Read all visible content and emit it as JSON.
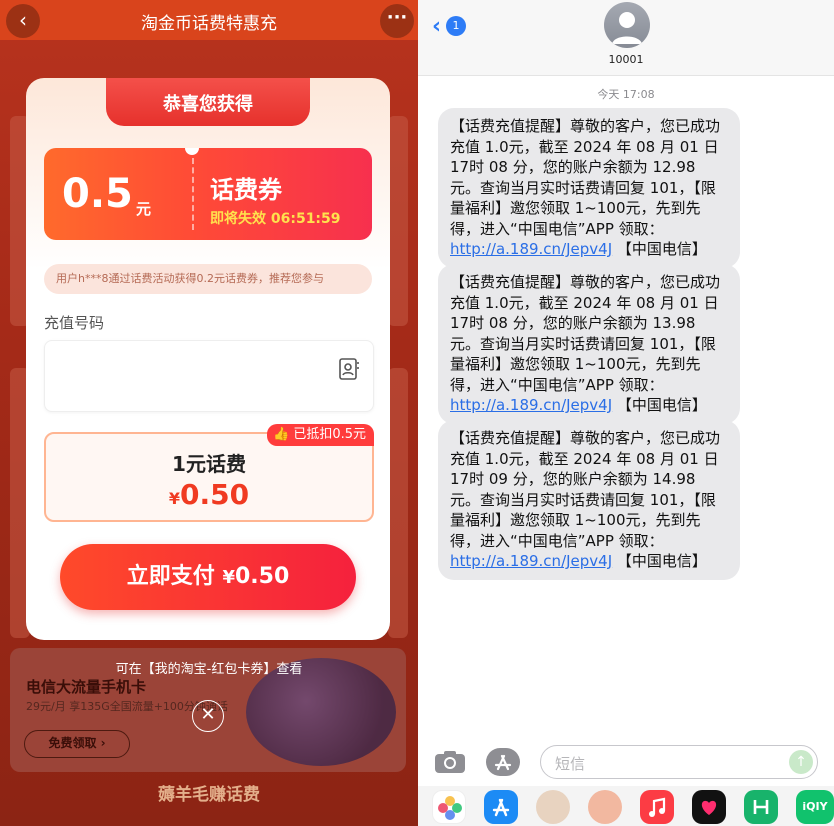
{
  "left": {
    "header": {
      "title": "淘金币话费特惠充",
      "back_icon": "chevron-left-icon",
      "more_icon": "more-dots-icon"
    },
    "modal": {
      "heading": "恭喜您获得",
      "coupon": {
        "amount": "0.5",
        "unit": "元",
        "name": "话费券",
        "expire_text": "即将失效 06:51:59"
      },
      "notice": "用户h***8通过话费活动获得0.2元话费券，推荐您参与",
      "phone_label": "充值号码",
      "phone_value": "",
      "product": {
        "badge": "已抵扣0.5元",
        "name": "1元话费",
        "currency": "¥",
        "price": "0.50"
      },
      "pay_button": {
        "label": "立即支付",
        "currency": "¥",
        "amount": "0.50"
      }
    },
    "below_tip": "可在【我的淘宝-红包卡券】查看",
    "promo": {
      "title": "电信大流量手机卡",
      "subtitle": "29元/月 享135G全国流量+100分钟通话",
      "button": "免费领取 ›"
    },
    "section_title": "薅羊毛赚话费"
  },
  "right": {
    "header": {
      "back_badge": "1",
      "contact_name": "10001"
    },
    "timestamp": "今天 17:08",
    "messages": [
      {
        "line1": "【话费充值提醒】尊敬的客户，您已成功充值 1.0元，截至 2024 年 08 月 01 日 17时 08 分，您的账户余额为 12.98 元。查询当月实时话费请回复 101，【限量福利】邀您领取 1~100元，先到先得，进入“中国电信”APP 领取：",
        "link": "http://a.189.cn/Jepv4J",
        "tail": " 【中国电信】"
      },
      {
        "line1": "【话费充值提醒】尊敬的客户，您已成功充值 1.0元，截至 2024 年 08 月 01 日 17时 08 分，您的账户余额为 13.98 元。查询当月实时话费请回复 101，【限量福利】邀您领取 1~100元，先到先得，进入“中国电信”APP 领取：",
        "link": "http://a.189.cn/Jepv4J",
        "tail": " 【中国电信】"
      },
      {
        "line1": "【话费充值提醒】尊敬的客户，您已成功充值 1.0元，截至 2024 年 08 月 01 日 17时 09 分，您的账户余额为 14.98 元。查询当月实时话费请回复 101，【限量福利】邀您领取 1~100元，先到先得，进入“中国电信”APP 领取：",
        "link": "http://a.189.cn/Jepv4J",
        "tail": " 【中国电信】"
      }
    ],
    "input_placeholder": "短信",
    "tray_apps": [
      "photos-icon",
      "app-store-icon",
      "memoji-icon",
      "memoji-2-icon",
      "music-icon",
      "digital-touch-icon",
      "app-green-icon",
      "iqiyi-icon"
    ],
    "tray_partial_label": "iQIY"
  },
  "colors": {
    "taobao_orange": "#ff4a2a",
    "imessage_blue": "#2e7cf6",
    "bubble_gray": "#e9e9eb",
    "coupon_yellow": "#ffe14d"
  }
}
